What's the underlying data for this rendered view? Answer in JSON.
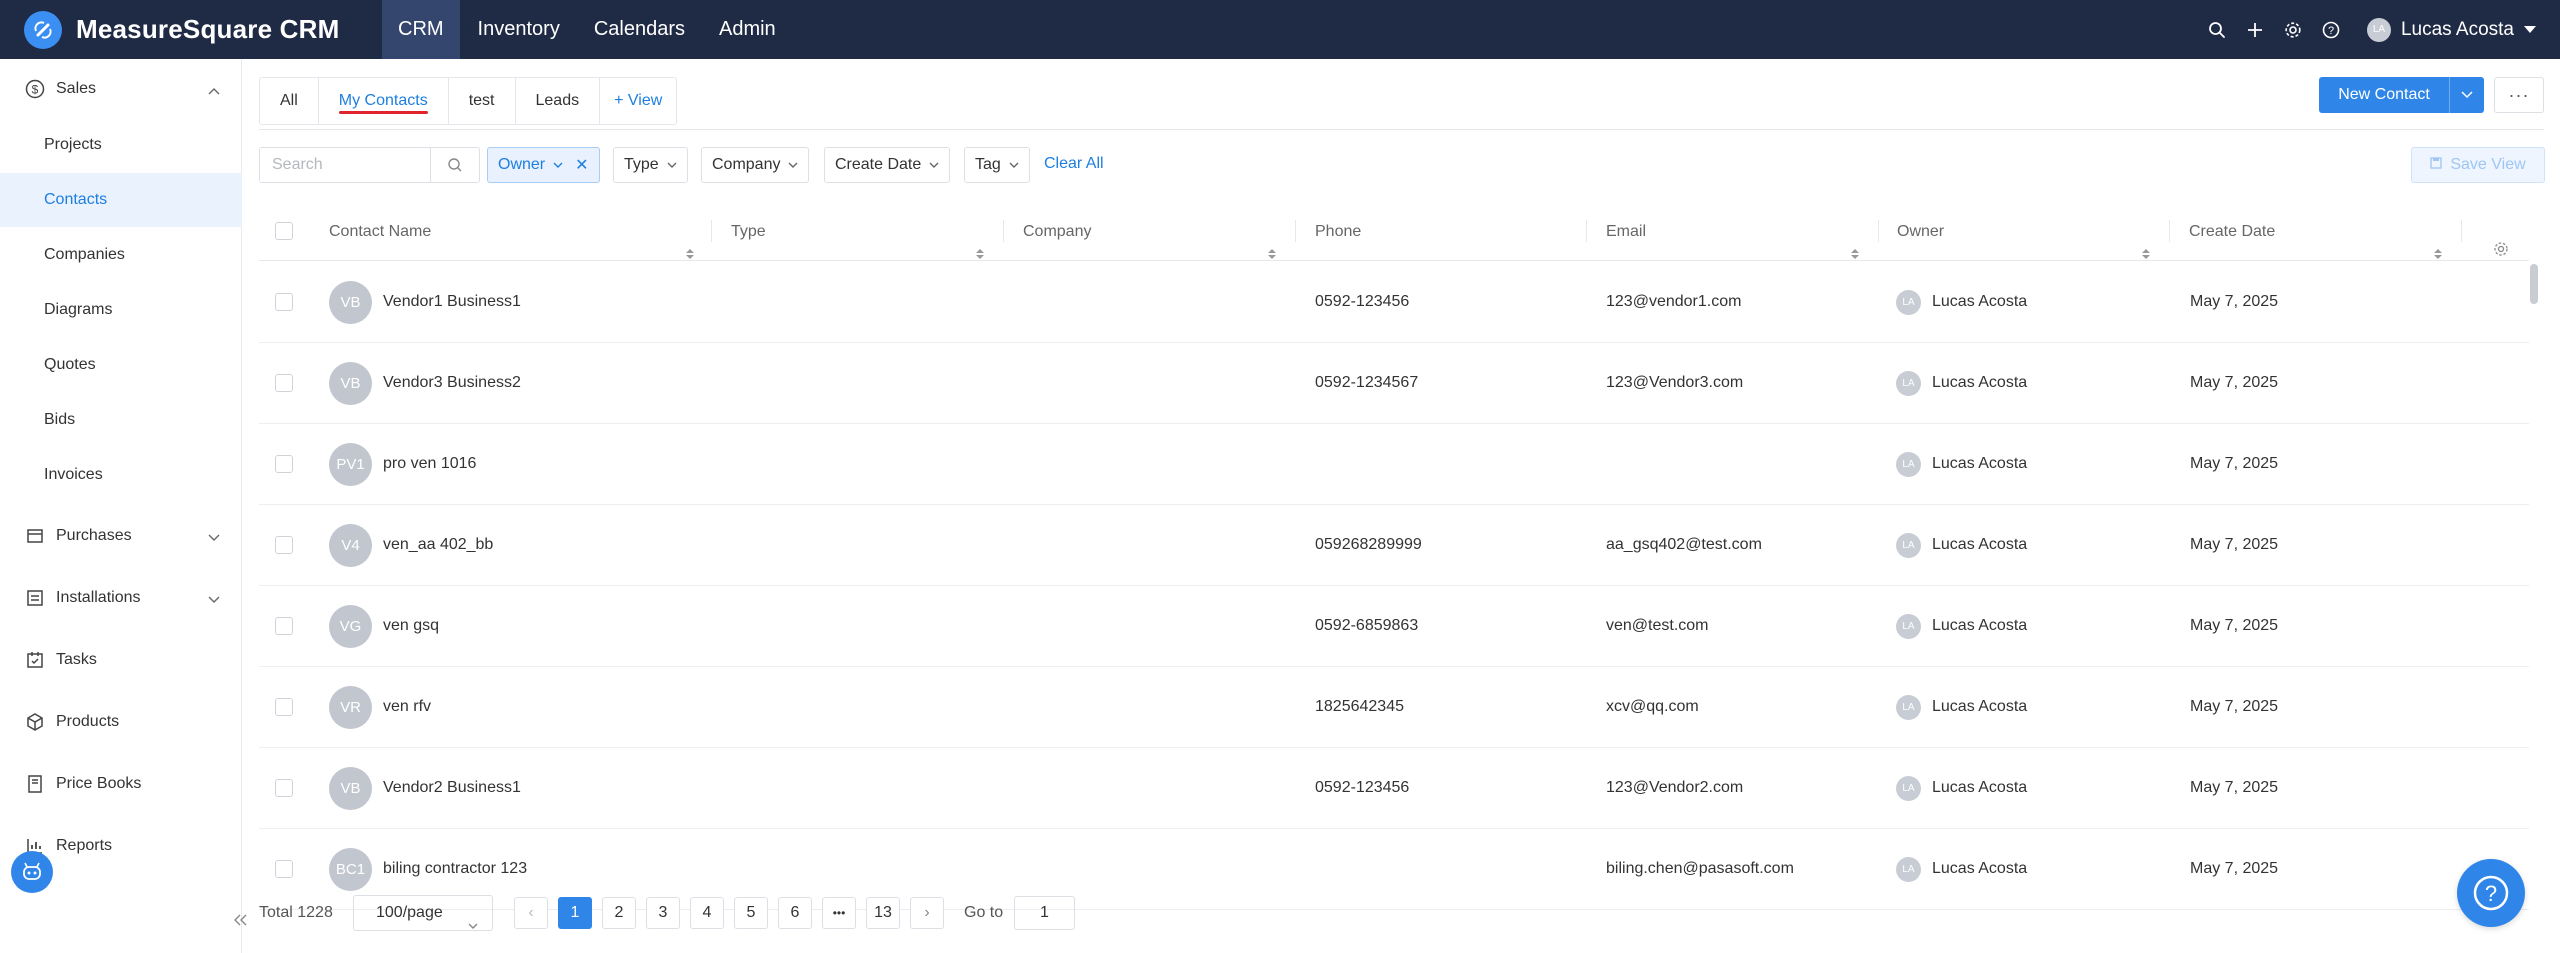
{
  "app": {
    "title": "MeasureSquare CRM"
  },
  "topnav": [
    {
      "label": "CRM",
      "active": true
    },
    {
      "label": "Inventory"
    },
    {
      "label": "Calendars"
    },
    {
      "label": "Admin"
    }
  ],
  "user": {
    "initials": "LA",
    "name": "Lucas Acosta"
  },
  "sidebar": {
    "groups": [
      {
        "label": "Sales",
        "icon": "dollar-circle-icon",
        "expanded": true,
        "items": [
          "Projects",
          "Contacts",
          "Companies",
          "Diagrams",
          "Quotes",
          "Bids",
          "Invoices"
        ],
        "active_item": "Contacts"
      },
      {
        "label": "Purchases",
        "icon": "receipt-icon"
      },
      {
        "label": "Installations",
        "icon": "list-icon"
      },
      {
        "label": "Tasks",
        "icon": "calendar-check-icon"
      },
      {
        "label": "Products",
        "icon": "box-icon"
      },
      {
        "label": "Price Books",
        "icon": "book-icon"
      },
      {
        "label": "Reports",
        "icon": "chart-icon"
      }
    ]
  },
  "views": {
    "tabs": [
      "All",
      "My Contacts",
      "test",
      "Leads"
    ],
    "active": "My Contacts",
    "add_label": "+ View"
  },
  "actions": {
    "new_contact": "New Contact",
    "more": "···"
  },
  "filters": {
    "search_placeholder": "Search",
    "chips": [
      "Owner",
      "Type",
      "Company",
      "Create Date",
      "Tag"
    ],
    "clear_all": "Clear All",
    "save_view": "Save View"
  },
  "table": {
    "columns": [
      "Contact Name",
      "Type",
      "Company",
      "Phone",
      "Email",
      "Owner",
      "Create Date"
    ],
    "rows": [
      {
        "initials": "VB",
        "name": "Vendor1 Business1",
        "type": "",
        "company": "",
        "phone": "0592-123456",
        "email": "123@vendor1.com",
        "owner_initials": "LA",
        "owner": "Lucas Acosta",
        "date": "May 7, 2025"
      },
      {
        "initials": "VB",
        "name": "Vendor3 Business2",
        "type": "",
        "company": "",
        "phone": "0592-1234567",
        "email": "123@Vendor3.com",
        "owner_initials": "LA",
        "owner": "Lucas Acosta",
        "date": "May 7, 2025"
      },
      {
        "initials": "PV1",
        "name": "pro ven 1016",
        "type": "",
        "company": "",
        "phone": "",
        "email": "",
        "owner_initials": "LA",
        "owner": "Lucas Acosta",
        "date": "May 7, 2025"
      },
      {
        "initials": "V4",
        "name": "ven_aa 402_bb",
        "type": "",
        "company": "",
        "phone": "059268289999",
        "email": "aa_gsq402@test.com",
        "owner_initials": "LA",
        "owner": "Lucas Acosta",
        "date": "May 7, 2025"
      },
      {
        "initials": "VG",
        "name": "ven gsq",
        "type": "",
        "company": "",
        "phone": "0592-6859863",
        "email": "ven@test.com",
        "owner_initials": "LA",
        "owner": "Lucas Acosta",
        "date": "May 7, 2025"
      },
      {
        "initials": "VR",
        "name": "ven rfv",
        "type": "",
        "company": "",
        "phone": "1825642345",
        "email": "xcv@qq.com",
        "owner_initials": "LA",
        "owner": "Lucas Acosta",
        "date": "May 7, 2025"
      },
      {
        "initials": "VB",
        "name": "Vendor2 Business1",
        "type": "",
        "company": "",
        "phone": "0592-123456",
        "email": "123@Vendor2.com",
        "owner_initials": "LA",
        "owner": "Lucas Acosta",
        "date": "May 7, 2025"
      },
      {
        "initials": "BC1",
        "name": "biling contractor 123",
        "type": "",
        "company": "",
        "phone": "",
        "email": "biling.chen@pasasoft.com",
        "owner_initials": "LA",
        "owner": "Lucas Acosta",
        "date": "May 7, 2025"
      }
    ]
  },
  "pagination": {
    "total": "Total 1228",
    "per_page": "100/page",
    "pages": [
      "1",
      "2",
      "3",
      "4",
      "5",
      "6",
      "•••",
      "13"
    ],
    "current": "1",
    "goto_label": "Go to",
    "goto_value": "1"
  },
  "colors": {
    "topbar": "#1f2a44",
    "accent": "#2f86e8",
    "active_bg": "#e9f2fd"
  }
}
